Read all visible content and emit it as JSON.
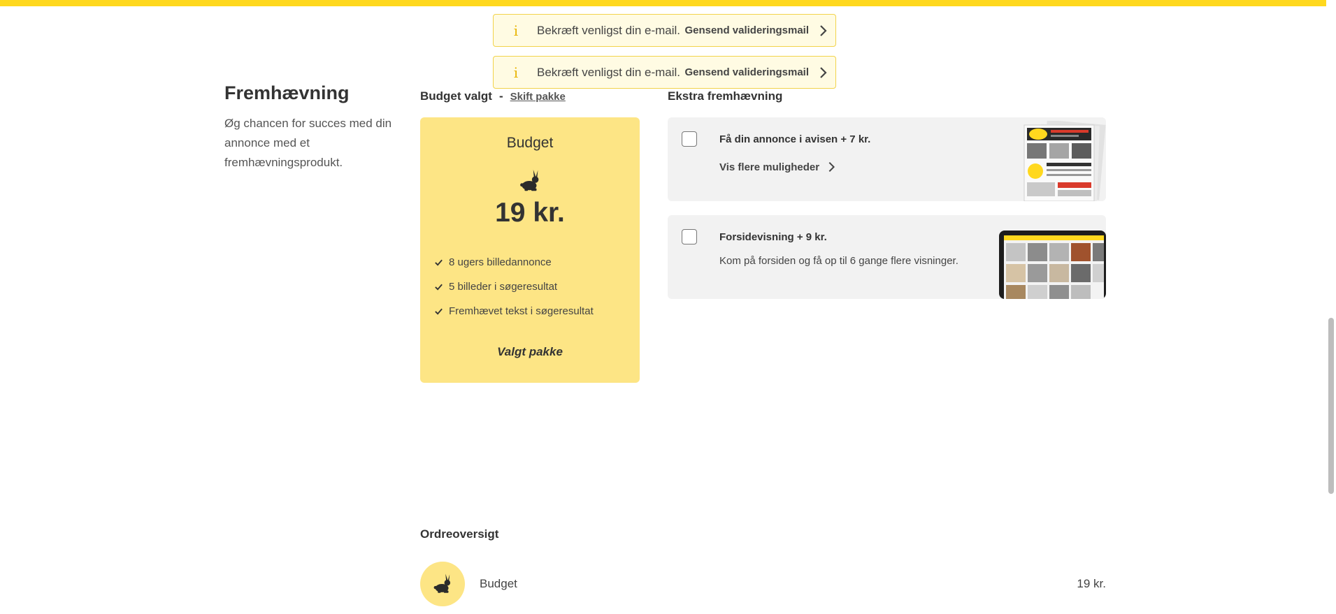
{
  "toasts": [
    {
      "message": "Bekræft venligst din e-mail.",
      "action": "Gensend valideringsmail"
    },
    {
      "message": "Bekræft venligst din e-mail.",
      "action": "Gensend valideringsmail"
    }
  ],
  "section": {
    "title": "Fremhævning",
    "description": "Øg chancen for succes med din annonce med et fremhævningsprodukt."
  },
  "budget": {
    "heading": "Budget valgt",
    "separator": "-",
    "change_link": "Skift pakke"
  },
  "package": {
    "name": "Budget",
    "icon": "rabbit-icon",
    "price": "19 kr.",
    "features": [
      "8 ugers billedannonce",
      "5 billeder i søgeresultat",
      "Fremhævet tekst i søgeresultat"
    ],
    "selected_label": "Valgt pakke"
  },
  "extra": {
    "heading": "Ekstra fremhævning",
    "options": [
      {
        "title": "Få din annonce i avisen + 7 kr.",
        "link": "Vis flere muligheder",
        "checked": false,
        "image": "newspaper-image"
      },
      {
        "title": "Forsidevisning + 9 kr.",
        "description": "Kom på forsiden og få op til 6 gange flere visninger.",
        "checked": false,
        "image": "tablet-frontpage-image"
      }
    ]
  },
  "order": {
    "heading": "Ordreoversigt",
    "items": [
      {
        "name": "Budget",
        "price": "19 kr.",
        "icon": "rabbit-icon"
      }
    ]
  },
  "colors": {
    "brand_yellow": "#ffd81e",
    "card_yellow": "#fde585",
    "toast_bg": "#fffbe3",
    "card_gray": "#f2f2f2"
  }
}
